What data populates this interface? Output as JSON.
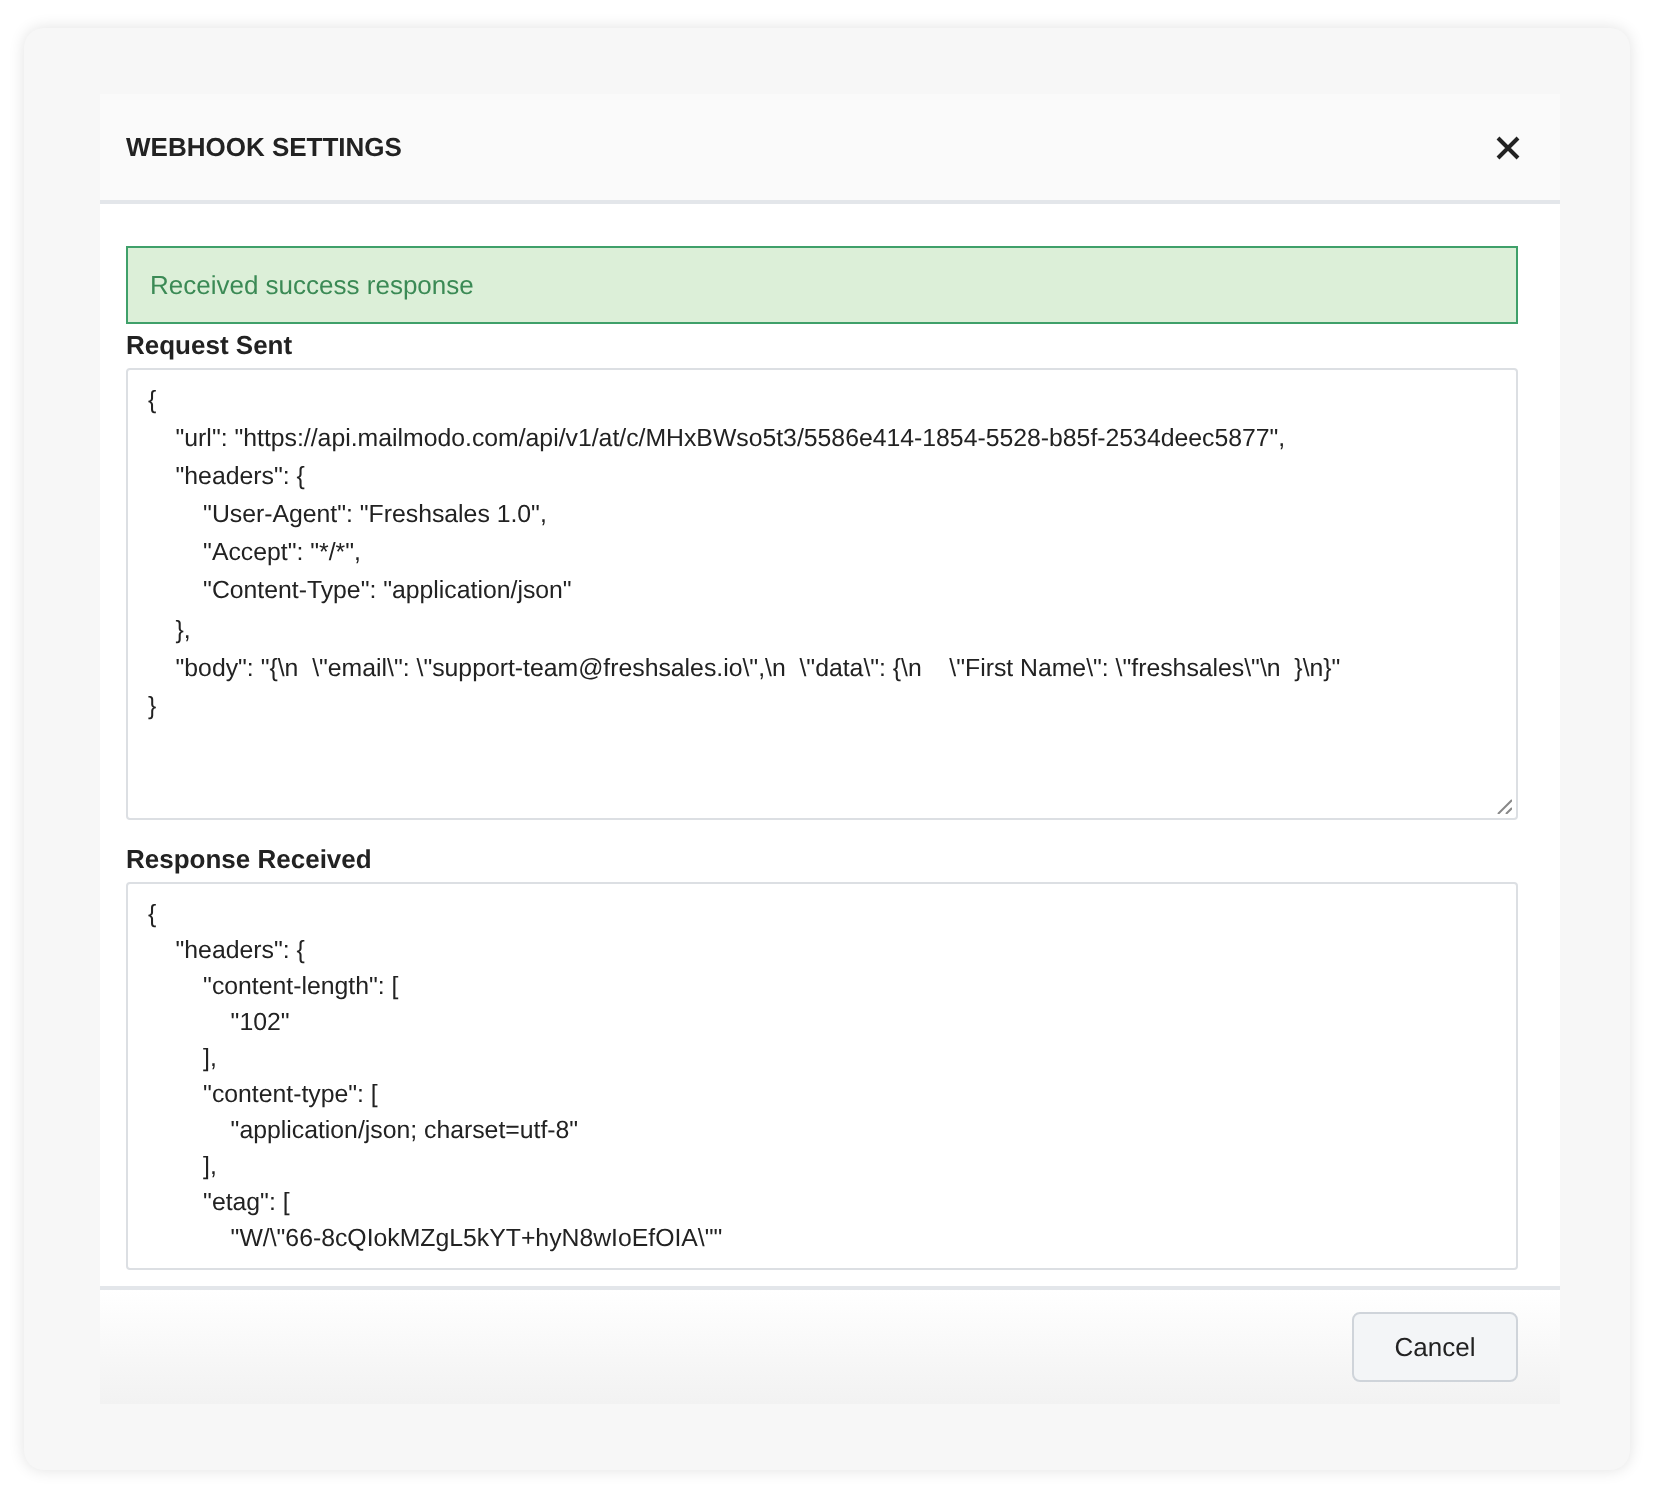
{
  "modal": {
    "title": "WEBHOOK SETTINGS"
  },
  "alert": {
    "kind": "success",
    "text": "Received success response"
  },
  "request": {
    "label": "Request Sent",
    "lines": [
      "{",
      "    \"url\": \"https://api.mailmodo.com/api/v1/at/c/MHxBWso5t3/5586e414-1854-5528-b85f-2534deec5877\",",
      "    \"headers\": {",
      "        \"User-Agent\": \"Freshsales 1.0\",",
      "        \"Accept\": \"*/*\",",
      "        \"Content-Type\": \"application/json\"",
      "    },",
      "    \"body\": \"{\\n  \\\"email\\\": \\\"support-team@freshsales.io\\\",\\n  \\\"data\\\": {\\n    \\\"First Name\\\": \\\"freshsales\\\"\\n  }\\n}\"",
      "}"
    ]
  },
  "response": {
    "label": "Response Received",
    "lines": [
      "{",
      "    \"headers\": {",
      "        \"content-length\": [",
      "            \"102\"",
      "        ],",
      "        \"content-type\": [",
      "            \"application/json; charset=utf-8\"",
      "        ],",
      "        \"etag\": [",
      "            \"W/\\\"66-8cQIokMZgL5kYT+hyN8wIoEfOIA\\\"\""
    ]
  },
  "buttons": [
    "Cancel"
  ]
}
